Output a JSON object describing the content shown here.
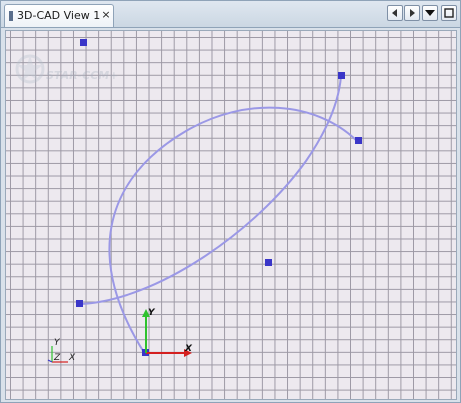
{
  "tab": {
    "label": "3D-CAD View 1",
    "close_glyph": "×"
  },
  "controls": [
    {
      "name": "scroll-left-button",
      "icon": "arrow-left-icon"
    },
    {
      "name": "scroll-right-button",
      "icon": "arrow-right-icon"
    },
    {
      "name": "view-menu-button",
      "icon": "triangle-down-icon"
    },
    {
      "name": "maximize-button",
      "icon": "square-icon"
    }
  ],
  "watermark": {
    "text": "STAR-CCM+"
  },
  "triad": {
    "x_label": "X",
    "y_label": "Y",
    "z_label": "Z"
  },
  "origin_axes": {
    "x_label": "X",
    "y_label": "Y"
  },
  "colors": {
    "curve": "#9b98e6",
    "control_point": "#3a36c8",
    "axis_x": "#d42020",
    "axis_y": "#2ec22e",
    "grid": "#9c98a4",
    "background": "#ede9ef"
  }
}
